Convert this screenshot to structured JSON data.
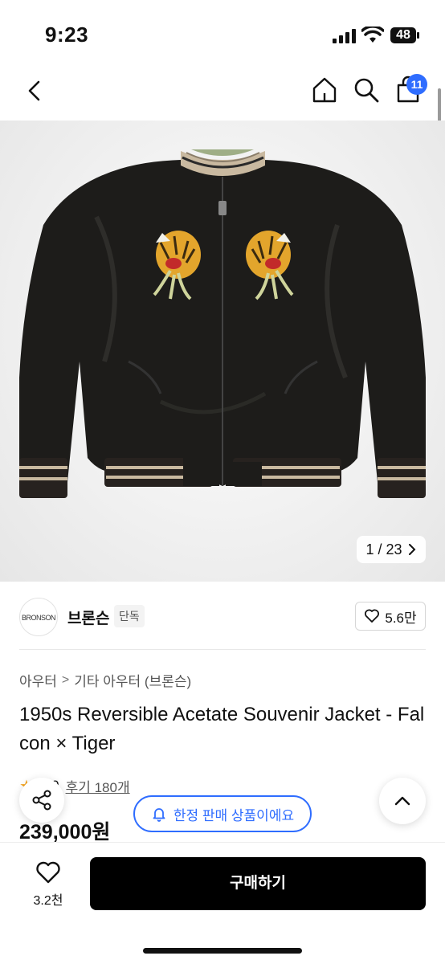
{
  "status_bar": {
    "time": "9:23",
    "battery": "48"
  },
  "nav": {
    "cart_count": "11"
  },
  "gallery": {
    "counter": "1 / 23"
  },
  "brand": {
    "logo_text": "BRONSON",
    "name": "브론슨",
    "tag": "단독",
    "likes": "5.6만"
  },
  "breadcrumb": {
    "level1": "아우터",
    "separator": ">",
    "level2": "기타 아우터 (브론슨)"
  },
  "product": {
    "title": "1950s Reversible Acetate Souvenir Jacket - Falcon × Tiger",
    "rating": "4.9",
    "reviews": "후기 180개",
    "price": "239,000원"
  },
  "floating": {
    "limited_label": "한정 판매 상품이에요"
  },
  "bottom_bar": {
    "wish_count": "3.2천",
    "buy_label": "구매하기"
  },
  "colors": {
    "accent": "#2f6dff",
    "buy_button": "#000000",
    "star": "#f5a623"
  }
}
